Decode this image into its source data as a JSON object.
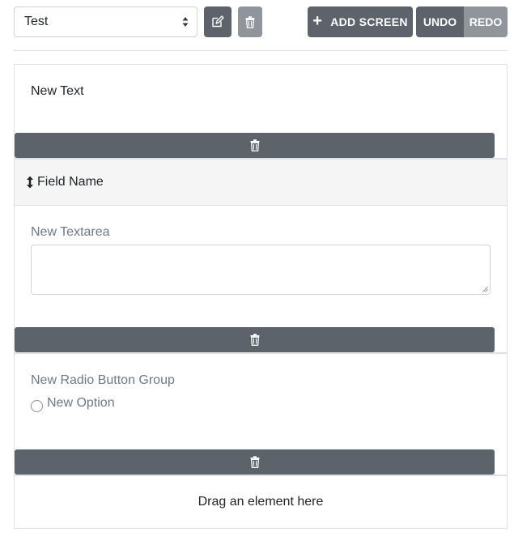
{
  "toolbar": {
    "screen_select_value": "Test",
    "add_screen_label": "ADD SCREEN",
    "undo_label": "UNDO",
    "redo_label": "REDO"
  },
  "elements": [
    {
      "type": "text",
      "text": "New Text"
    },
    {
      "type": "textarea",
      "header": "Field Name",
      "label": "New Textarea",
      "value": ""
    },
    {
      "type": "radio_group",
      "label": "New Radio Button Group",
      "options": [
        "New Option"
      ]
    }
  ],
  "dropzone": {
    "text": "Drag an element here"
  },
  "colors": {
    "button_dark": "#5c636a",
    "button_disabled": "#8f959b",
    "border": "#dee2e6",
    "header_bg": "#f5f5f5",
    "muted_label": "#6c7a89"
  },
  "icons": [
    "chevron-updown-icon",
    "edit-icon",
    "trash-icon",
    "plus-icon",
    "vertical-arrows-icon",
    "resize-grip-icon"
  ]
}
